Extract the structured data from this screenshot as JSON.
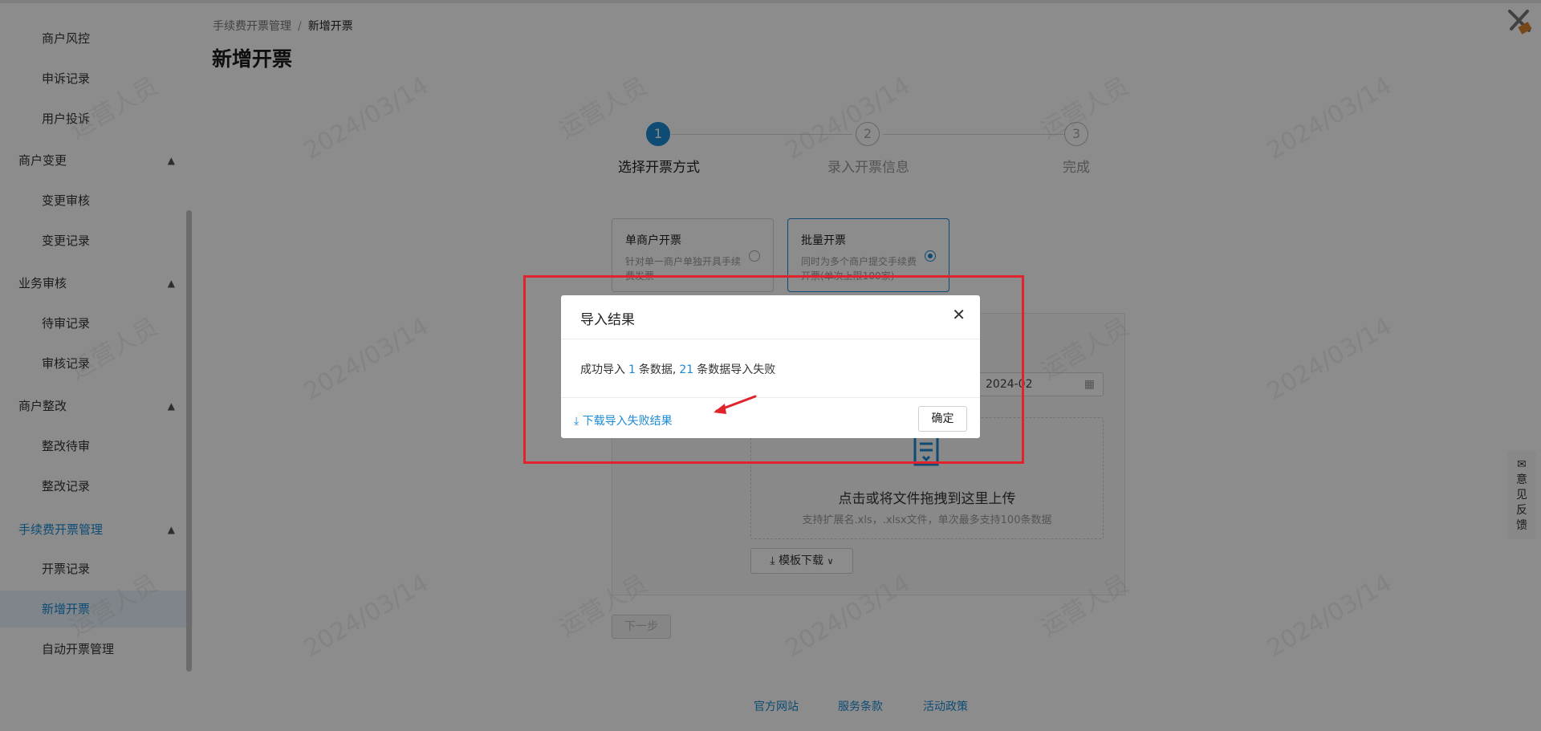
{
  "sidebar": {
    "items": [
      {
        "label": "商户风控",
        "kind": "sub"
      },
      {
        "label": "申诉记录",
        "kind": "sub"
      },
      {
        "label": "用户投诉",
        "kind": "sub"
      },
      {
        "label": "商户变更",
        "kind": "group"
      },
      {
        "label": "变更审核",
        "kind": "sub"
      },
      {
        "label": "变更记录",
        "kind": "sub"
      },
      {
        "label": "业务审核",
        "kind": "group"
      },
      {
        "label": "待审记录",
        "kind": "sub"
      },
      {
        "label": "审核记录",
        "kind": "sub"
      },
      {
        "label": "商户整改",
        "kind": "group"
      },
      {
        "label": "整改待审",
        "kind": "sub"
      },
      {
        "label": "整改记录",
        "kind": "sub"
      },
      {
        "label": "手续费开票管理",
        "kind": "group-active"
      },
      {
        "label": "开票记录",
        "kind": "sub"
      },
      {
        "label": "新增开票",
        "kind": "sub-active"
      },
      {
        "label": "自动开票管理",
        "kind": "sub"
      }
    ]
  },
  "breadcrumb": {
    "parent": "手续费开票管理",
    "separator": "/",
    "current": "新增开票"
  },
  "page_title": "新增开票",
  "steps": [
    {
      "num": "1",
      "label": "选择开票方式"
    },
    {
      "num": "2",
      "label": "录入开票信息"
    },
    {
      "num": "3",
      "label": "完成"
    }
  ],
  "options": {
    "single": {
      "title": "单商户开票",
      "desc": "针对单一商户单独开具手续费发票"
    },
    "batch": {
      "title": "批量开票",
      "desc": "同时为多个商户提交手续费开票(单次上限100家)"
    }
  },
  "date_value": "2024-02",
  "upload": {
    "title": "点击或将文件拖拽到这里上传",
    "hint": "支持扩展名.xls，.xlsx文件，单次最多支持100条数据"
  },
  "template_button": "模板下载",
  "next_button": "下一步",
  "footer": {
    "site": "官方网站",
    "terms": "服务条款",
    "policy": "活动政策"
  },
  "feedback": [
    "意",
    "见",
    "反",
    "馈"
  ],
  "watermark": {
    "name": "运营人员",
    "date": "2024/03/14"
  },
  "modal": {
    "title": "导入结果",
    "msg_prefix": "成功导入",
    "success_count": "1",
    "msg_mid": "条数据,",
    "fail_count": "21",
    "msg_suffix": "条数据导入失败",
    "download_link": "下载导入失败结果",
    "ok_button": "确定"
  },
  "colors": {
    "accent": "#1a8ad3",
    "annotation": "#e0232c"
  }
}
